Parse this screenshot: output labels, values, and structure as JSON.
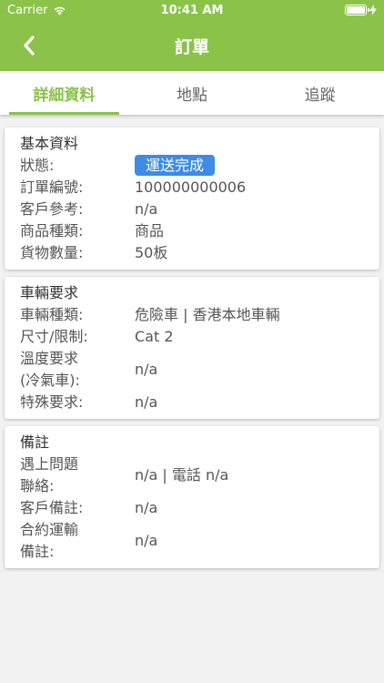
{
  "status_bar": {
    "carrier": "Carrier",
    "time": "10:41 AM"
  },
  "nav": {
    "title": "訂單"
  },
  "tabs": [
    {
      "label": "詳細資料",
      "active": true
    },
    {
      "label": "地點",
      "active": false
    },
    {
      "label": "追蹤",
      "active": false
    }
  ],
  "sections": {
    "basic": {
      "title": "基本資料",
      "status_label": "狀態:",
      "status_value": "運送完成",
      "order_no_label": "訂單編號:",
      "order_no_value": "100000000006",
      "customer_ref_label": "客戶參考:",
      "customer_ref_value": "n/a",
      "product_type_label": "商品種類:",
      "product_type_value": "商品",
      "quantity_label": "貨物數量:",
      "quantity_value": "50板"
    },
    "vehicle": {
      "title": "車輛要求",
      "type_label": "車輛種類:",
      "type_value": "危險車 | 香港本地車輛",
      "size_label": "尺寸/限制:",
      "size_value": "Cat 2",
      "temp_label_line1": "溫度要求",
      "temp_label_line2": "(冷氣車):",
      "temp_value": "n/a",
      "special_label": "特殊要求:",
      "special_value": "n/a"
    },
    "notes": {
      "title": "備註",
      "contact_label_line1": "遇上問題",
      "contact_label_line2": "聯絡:",
      "contact_value": "n/a | 電話 n/a",
      "customer_note_label": "客戶備註:",
      "customer_note_value": "n/a",
      "contract_label_line1": "合約運輸",
      "contract_label_line2": "備註:",
      "contract_value": "n/a"
    }
  },
  "colors": {
    "primary": "#8bc34a",
    "badge": "#3d8be6"
  },
  "icons": [
    "wifi-icon",
    "charging-icon",
    "battery-icon",
    "back-chevron-icon"
  ]
}
